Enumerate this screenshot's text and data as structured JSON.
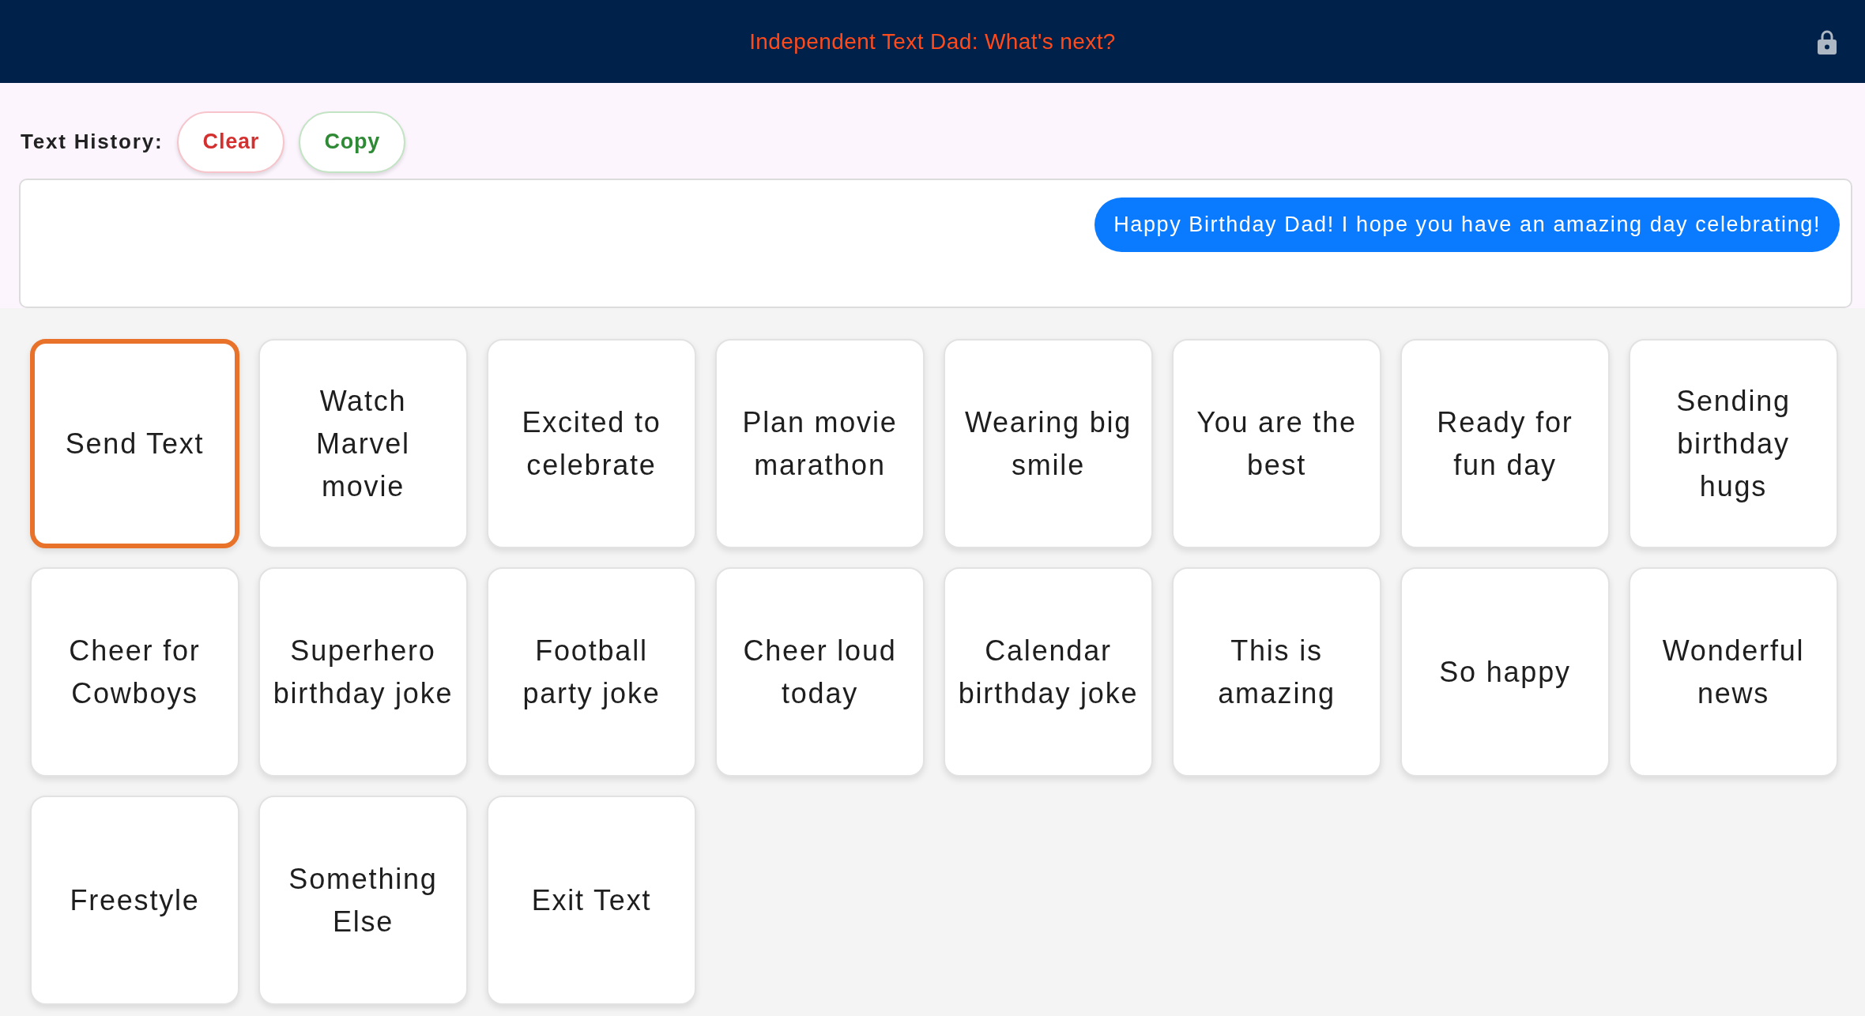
{
  "header": {
    "title": "Independent Text Dad: What's next?"
  },
  "history": {
    "label": "Text History:",
    "buttons": [
      {
        "label": "Clear",
        "kind": "clear"
      },
      {
        "label": "Copy",
        "kind": "copy"
      }
    ],
    "messages": [
      {
        "text": "Happy Birthday Dad! I hope you have an amazing day celebrating!"
      }
    ]
  },
  "tiles": [
    {
      "label": "Send Text",
      "selected": true
    },
    {
      "label": "Watch Marvel movie",
      "selected": false
    },
    {
      "label": "Excited to celebrate",
      "selected": false
    },
    {
      "label": "Plan movie marathon",
      "selected": false
    },
    {
      "label": "Wearing big smile",
      "selected": false
    },
    {
      "label": "You are the best",
      "selected": false
    },
    {
      "label": "Ready for fun day",
      "selected": false
    },
    {
      "label": "Sending birthday hugs",
      "selected": false
    },
    {
      "label": "Cheer for Cowboys",
      "selected": false
    },
    {
      "label": "Superhero birthday joke",
      "selected": false
    },
    {
      "label": "Football party joke",
      "selected": false
    },
    {
      "label": "Cheer loud today",
      "selected": false
    },
    {
      "label": "Calendar birthday joke",
      "selected": false
    },
    {
      "label": "This is amazing",
      "selected": false
    },
    {
      "label": "So happy",
      "selected": false
    },
    {
      "label": "Wonderful news",
      "selected": false
    },
    {
      "label": "Freestyle",
      "selected": false
    },
    {
      "label": "Something Else",
      "selected": false
    },
    {
      "label": "Exit Text",
      "selected": false
    }
  ]
}
